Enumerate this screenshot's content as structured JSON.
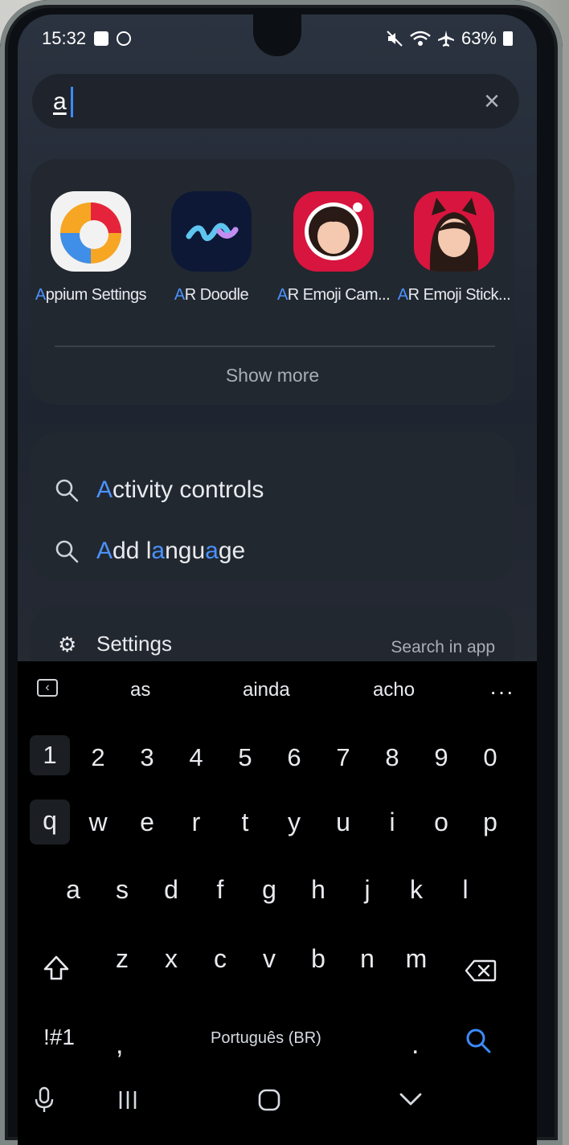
{
  "status_bar": {
    "time": "15:32",
    "icons_left": [
      "calendar-check-icon",
      "messenger-icon"
    ],
    "icons_right": [
      "mute-icon",
      "wifi-icon",
      "airplane-icon"
    ],
    "battery": "63%"
  },
  "search": {
    "query": "a",
    "clear_icon": "close-icon"
  },
  "apps": {
    "items": [
      {
        "label_highlight": "A",
        "label_rest": "ppium Settings",
        "icon": "appium-icon"
      },
      {
        "label_highlight": "A",
        "label_rest": "R Doodle",
        "icon": "ar-doodle-icon"
      },
      {
        "label_highlight": "A",
        "label_rest": "R Emoji Cam...",
        "icon": "ar-emoji-camera-icon"
      },
      {
        "label_highlight": "A",
        "label_rest": "R Emoji Stick...",
        "icon": "ar-emoji-stickers-icon"
      }
    ],
    "show_more": "Show more"
  },
  "results": {
    "items": [
      {
        "parts": [
          "A",
          "ctivity controls"
        ],
        "icon": "search-icon"
      },
      {
        "parts": [
          "A",
          "dd l",
          "a",
          "ngu",
          "a",
          "ge"
        ],
        "icon": "search-icon"
      }
    ]
  },
  "settings_section": {
    "title": "Settings",
    "action": "Search in app",
    "icon": "gear-icon"
  },
  "keyboard": {
    "suggestions": [
      "as",
      "ainda",
      "acho"
    ],
    "more": "···",
    "numbers": [
      "1",
      "2",
      "3",
      "4",
      "5",
      "6",
      "7",
      "8",
      "9",
      "0"
    ],
    "row1": [
      "q",
      "w",
      "e",
      "r",
      "t",
      "y",
      "u",
      "i",
      "o",
      "p"
    ],
    "row2": [
      "a",
      "s",
      "d",
      "f",
      "g",
      "h",
      "j",
      "k",
      "l"
    ],
    "row3": [
      "z",
      "x",
      "c",
      "v",
      "b",
      "n",
      "m"
    ],
    "symbols": "!#1",
    "comma": ",",
    "space": "Português (BR)",
    "period": ".",
    "accent_color": "#3d8bff"
  },
  "nav": {
    "icons": [
      "microphone-icon",
      "recents-icon",
      "home-icon",
      "back-icon"
    ]
  }
}
